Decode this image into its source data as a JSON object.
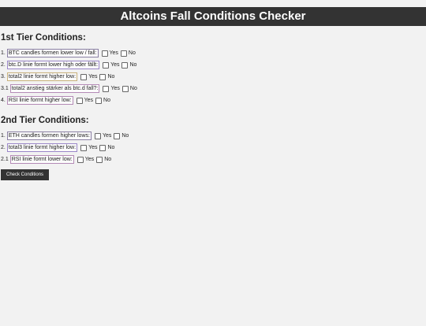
{
  "header": {
    "title": "Altcoins Fall Conditions Checker"
  },
  "tier1": {
    "title": "1st Tier Conditions:",
    "items": [
      {
        "num": "1.",
        "label": "BTC candles formen lower low / fall:",
        "yes": "Yes",
        "no": "No"
      },
      {
        "num": "2.",
        "label": "btc.D linie formt lower high oder fällt:",
        "yes": "Yes",
        "no": "No"
      },
      {
        "num": "3.",
        "label": "total2 linie formt higher low:",
        "yes": "Yes",
        "no": "No"
      },
      {
        "num": "3.1",
        "label": "total2 anstieg stärker als btc.d fall?:",
        "yes": "Yes",
        "no": "No"
      },
      {
        "num": "4.",
        "label": "RSI linie formt higher low:",
        "yes": "Yes",
        "no": "No"
      }
    ]
  },
  "tier2": {
    "title": "2nd Tier Conditions:",
    "items": [
      {
        "num": "1.",
        "label": "ETH candles formen higher lows:",
        "yes": "Yes",
        "no": "No"
      },
      {
        "num": "2.",
        "label": "total3 linie formt higher low:",
        "yes": "Yes",
        "no": "No"
      },
      {
        "num": "2.1",
        "label": "RSI linie formt lower low:",
        "yes": "Yes",
        "no": "No"
      }
    ]
  },
  "button": {
    "label": "Check Conditions"
  }
}
